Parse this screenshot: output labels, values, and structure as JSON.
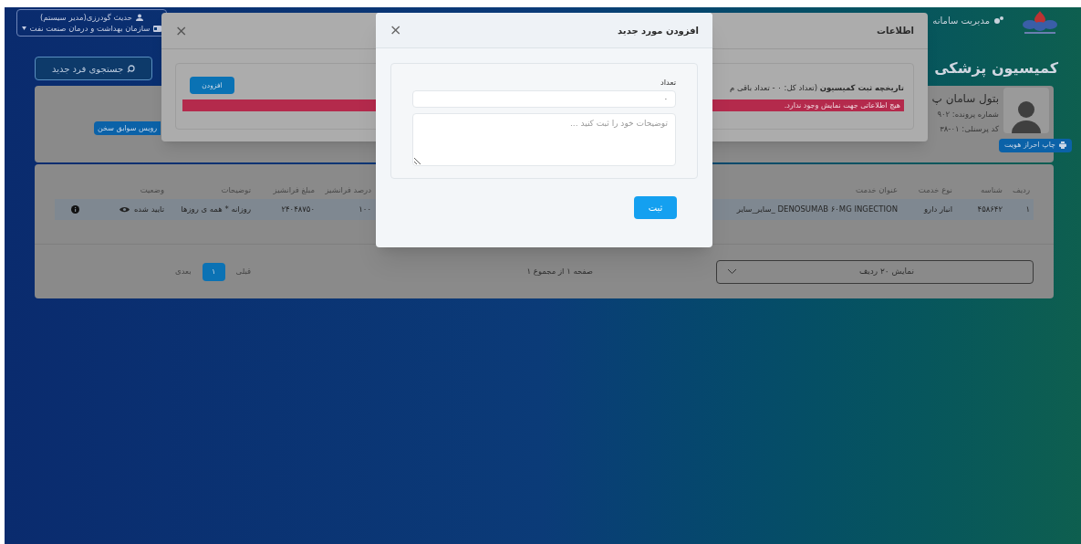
{
  "header": {
    "menu_item": "مدیریت سامانه",
    "user_name": "حدیث گودرزی(مدیر سیستم)",
    "organization": "سازمان بهداشت و درمان صنعت نفت"
  },
  "page_title": "کمیسیون پزشکی",
  "search_button": "جستجوی فرد جدید",
  "profile": {
    "name": "بتول سامان پ",
    "file_number": "شماره پرونده: ۹۰۲",
    "personnel_code": "کد پرسنلی: ۰۱-۳۸",
    "print_button": "چاپ احراز هویت",
    "history_button": "رویس سوابق سخن"
  },
  "table": {
    "columns": [
      "ردیف",
      "شناسه",
      "نوع خدمت",
      "عنوان خدمت",
      "درصد فرانشیز",
      "مبلغ فرانشیز",
      "توضیحات",
      "وضعیت"
    ],
    "rows": [
      {
        "cells": [
          "۱",
          "۴۵۸۶۴۲",
          "انبار دارو",
          "DENOSUMAB ۶۰MG INGECTION _سایر_سایر",
          "۱۰۰",
          "۲۴۰۴۸۷۵۰",
          "روزانه * همه ی روزها",
          "تایید شده"
        ]
      }
    ]
  },
  "footer": {
    "page_size": "نمایش ۲۰ ردیف",
    "page_info": "صفحه ۱ از مجموع ۱",
    "pagination": [
      {
        "label": "قبلی",
        "selected": false
      },
      {
        "label": "۱",
        "selected": true
      },
      {
        "label": "بعدی",
        "selected": false
      }
    ]
  },
  "info_dialog": {
    "title": "اطلاعات",
    "close": "×",
    "history": "**تاریخچه ثبت کمیسیون** (تعداد کل: ۰ - تعداد باقی م",
    "alert": "هیچ اطلاعاتی جهت نمایش وجود ندارد.",
    "add_button": "افزودن"
  },
  "add_dialog": {
    "title": "افزودن مورد جدید",
    "close": "×",
    "count_label": "تعداد",
    "count_value": "۰",
    "notes_placeholder": "توضیحات خود را ثبت کنید ...",
    "submit": "ثبت"
  }
}
